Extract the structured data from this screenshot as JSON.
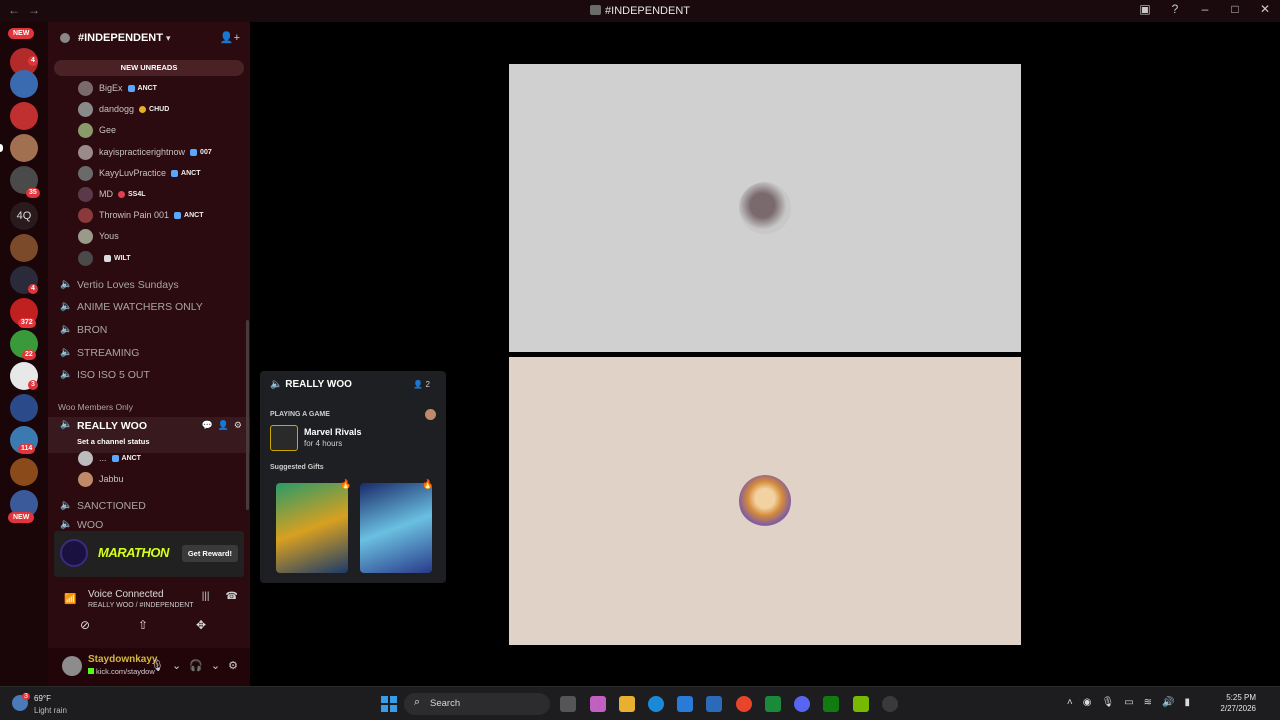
{
  "window": {
    "title": "#INDEPENDENT"
  },
  "rail": {
    "new_label_top": "NEW",
    "new_label_bottom": "NEW",
    "text_server": "4Q",
    "badges": [
      "4",
      "35",
      "4",
      "372",
      "22",
      "3",
      "114"
    ]
  },
  "server": {
    "name": "#INDEPENDENT",
    "new_unreads": "NEW UNREADS"
  },
  "members": [
    {
      "name": "BigEx",
      "tag": "ANCT"
    },
    {
      "name": "dandogg",
      "tag": "CHUD"
    },
    {
      "name": "Gee",
      "tag": ""
    },
    {
      "name": "kayispracticerightnow",
      "tag": "007"
    },
    {
      "name": "KayyLuvPractice",
      "tag": "ANCT"
    },
    {
      "name": "MD",
      "tag": "SS4L"
    },
    {
      "name": "Throwin Pain 001",
      "tag": "ANCT"
    },
    {
      "name": "Yous",
      "tag": ""
    },
    {
      "name": "",
      "tag": "WILT"
    }
  ],
  "channels": [
    "Vertio Loves Sundays",
    "ANIME WATCHERS ONLY",
    "BRON",
    "STREAMING",
    "ISO ISO 5 OUT"
  ],
  "category": "Woo Members Only",
  "active_channel": {
    "name": "REALLY WOO",
    "status": "Set a channel status"
  },
  "active_members": [
    {
      "name": "...",
      "tag": "ANCT"
    },
    {
      "name": "Jabbu",
      "tag": ""
    }
  ],
  "more_channels": [
    "SANCTIONED",
    "WOO"
  ],
  "promo": {
    "name": "MARATHON",
    "button": "Get Reward!"
  },
  "voice": {
    "status": "Voice Connected",
    "location": "REALLY WOO / #INDEPENDENT"
  },
  "user": {
    "name": "Staydownkayy",
    "sub": "kick.com/staydow"
  },
  "popup": {
    "channel": "REALLY WOO",
    "count": "2",
    "section": "PLAYING A GAME",
    "game": "Marvel Rivals",
    "duration": "for 4 hours",
    "gifts_label": "Suggested Gifts"
  },
  "taskbar": {
    "temp": "69°F",
    "weather": "Light rain",
    "search": "Search",
    "time": "5:25 PM",
    "date": "2/27/2026",
    "weather_badge": "3"
  }
}
